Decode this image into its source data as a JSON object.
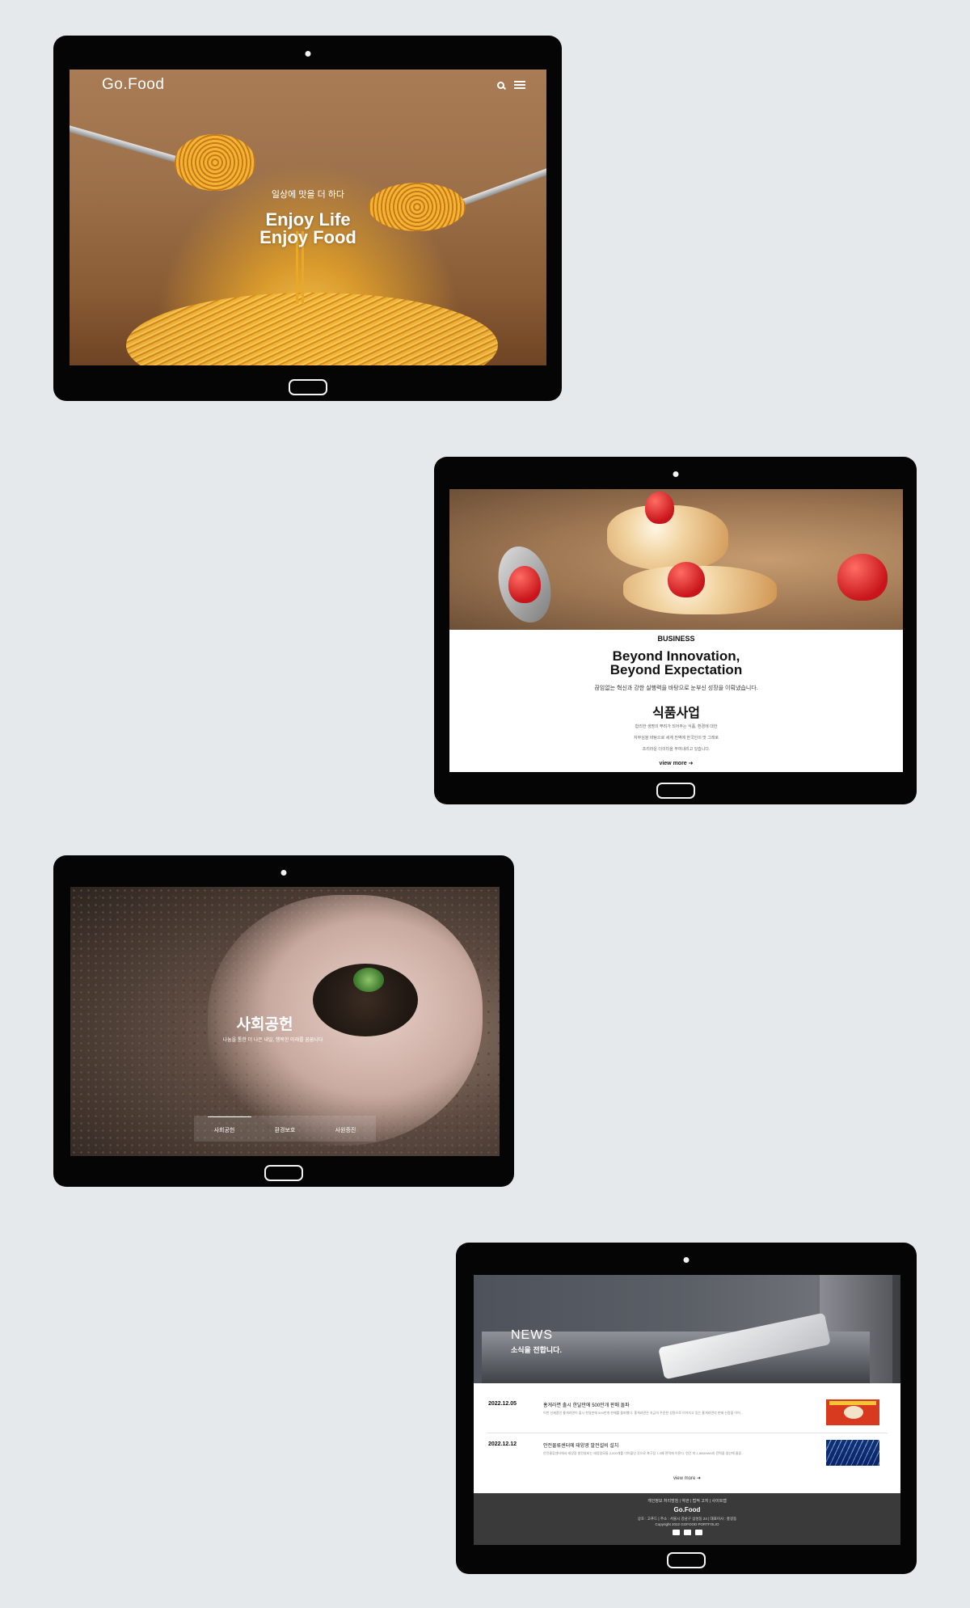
{
  "tablet1": {
    "logo": "Go.Food",
    "subtitle": "일상에 맛을 더 하다",
    "headline1": "Enjoy Life",
    "headline2": "Enjoy Food"
  },
  "tablet2": {
    "label": "BUSINESS",
    "headline1": "Beyond Innovation,",
    "headline2": "Beyond Expectation",
    "description": "끊임없는 혁신과 강한 실행력을 바탕으로 눈부신 성장을 이뤄냈습니다.",
    "section_title": "식품사업",
    "paragraph_lines": [
      "합리한 생명의 뿌려가 되어주는 식품, 환경에 대한",
      "자부심을 바탕으로 세계 전역에 한국인의 맛 그래로",
      "조리라운 더의미을 부여내리고 있습니다."
    ],
    "view_more": "view more"
  },
  "tablet3": {
    "headline": "사회공헌",
    "subtitle": "나눔을 통한 더 나은 내일, 행복한 미래를 꿈꿉니다",
    "tabs": [
      "사회공헌",
      "환경보호",
      "사원증진"
    ]
  },
  "tablet4": {
    "news_title": "NEWS",
    "news_subtitle": "소식을 전합니다.",
    "items": [
      {
        "date": "2022.12.05",
        "headline": "홍게라면 출시 한달만에 500만개 판매 돌파",
        "body": "이번 신제품인 홍게라면이 출시 한달만에 500만개 판매를 돌파했다. 홍게라면은 지금의 꾸준한 성원으로 이어지고 있는 홍게라면의 판매 신장을 이어..."
      },
      {
        "date": "2022.12.12",
        "headline": "안전물류센터에 태양광 발전설비 설치",
        "body": "안전물류센터에서 태양광 발전설비는 태양광모듈 2,000개를 이어붙인 것으로 축구장 1.3배 면적에 이른다. 연간 약 1,800MWh의 전력을 생산해 물류..."
      }
    ],
    "view_more": "view more",
    "footer_links": "개인정보 처리방침 | 약관 | 법적 고지 | 사이트맵",
    "footer_logo": "Go.Food",
    "footer_address": "상호 : 고푸드 | 주소 : 서울시 강남구 삼성동 24 | 대표이사 : 홍길동",
    "footer_copyright": "Copyright 2022 GOFOOD PORTFOLIO"
  },
  "icons": [
    "search-icon",
    "menu-icon",
    "arrow-right-icon",
    "facebook-icon",
    "youtube-icon",
    "twitter-icon"
  ],
  "colors": {
    "background": "#e6e9ec",
    "device": "#050505",
    "footer": "#3a3a3a"
  }
}
